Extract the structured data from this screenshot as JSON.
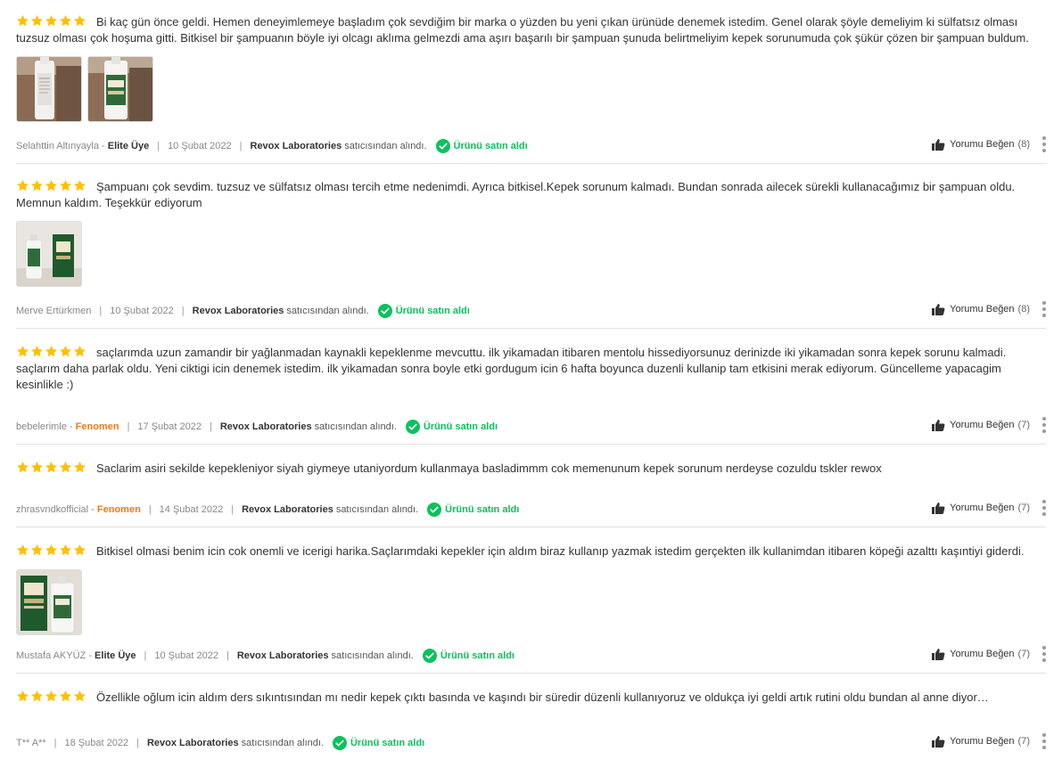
{
  "reviews": [
    {
      "rating": 5,
      "text": "Bi kaç gün önce geldi. Hemen deneyimlemeye başladım çok sevdiğim bir marka o yüzden bu yeni çıkan ürünüde denemek istedim. Genel olarak şöyle demeliyim ki sülfatsız olması tuzsuz olması çok hoşuma gitti. Bitkisel bir şampuanın böyle iyi olcagı aklıma gelmezdi ama aşırı başarılı bir şampuan şunuda belirtmeliyim kepek sorunumuda çok şükür çözen bir şampuan buldum.",
      "photos": [
        "bottle-back",
        "bottle-front"
      ],
      "user": "Selahttin Altınyayla",
      "badge": "Elite Üye",
      "badge_type": "elite",
      "date": "10 Şubat 2022",
      "seller": "Revox Laboratories",
      "seller_suffix": "satıcısından alındı.",
      "bought": "Ürünü satın aldı",
      "like_label": "Yorumu Beğen",
      "like_count": "(8)"
    },
    {
      "rating": 5,
      "text": "Şampuanı çok sevdim. tuzsuz ve sülfatsız olması tercih etme nedenimdi. Ayrıca bitkisel.Kepek sorunum kalmadı. Bundan sonrada ailecek sürekli kullanacağımız bir şampuan oldu. Memnun kaldım. Teşekkür ediyorum",
      "photos": [
        "two-products"
      ],
      "user": "Merve Ertürkmen",
      "badge": "",
      "badge_type": "",
      "date": "10 Şubat 2022",
      "seller": "Revox Laboratories",
      "seller_suffix": "satıcısından alındı.",
      "bought": "Ürünü satın aldı",
      "like_label": "Yorumu Beğen",
      "like_count": "(8)"
    },
    {
      "rating": 5,
      "text": "saçlarımda uzun zamandir bir yağlanmadan kaynakli kepeklenme mevcuttu. ilk yikamadan itibaren mentolu hissediyorsunuz derinizde iki yikamadan sonra kepek sorunu kalmadi. saçlarım daha parlak oldu. Yeni ciktigi icin denemek istedim. ilk yikamadan sonra boyle etki gordugum icin 6 hafta boyunca duzenli kullanip tam etkisini merak ediyorum. Güncelleme yapacagim kesinlikle :)",
      "photos": [],
      "user": "bebelerimle",
      "badge": "Fenomen",
      "badge_type": "fenomen",
      "date": "17 Şubat 2022",
      "seller": "Revox Laboratories",
      "seller_suffix": "satıcısından alındı.",
      "bought": "Ürünü satın aldı",
      "like_label": "Yorumu Beğen",
      "like_count": "(7)"
    },
    {
      "rating": 5,
      "text": "Saclarim asiri sekilde kepekleniyor siyah giymeye utaniyordum kullanmaya basladimmm cok memenunum kepek sorunum nerdeyse cozuldu tskler rewox",
      "photos": [],
      "user": "zhrasvndkofficial",
      "badge": "Fenomen",
      "badge_type": "fenomen",
      "date": "14 Şubat 2022",
      "seller": "Revox Laboratories",
      "seller_suffix": "satıcısından alındı.",
      "bought": "Ürünü satın aldı",
      "like_label": "Yorumu Beğen",
      "like_count": "(7)"
    },
    {
      "rating": 5,
      "text": "Bitkisel olmasi benim icin cok onemli ve icerigi harika.Saçlarımdaki kepekler için aldım biraz kullanıp yazmak istedim gerçekten ilk kullanimdan itibaren köpeği azalttı kaşıntiyi giderdi.",
      "photos": [
        "box-and-bottle"
      ],
      "user": "Mustafa AKYÜZ",
      "badge": "Elite Üye",
      "badge_type": "elite",
      "date": "10 Şubat 2022",
      "seller": "Revox Laboratories",
      "seller_suffix": "satıcısından alındı.",
      "bought": "Ürünü satın aldı",
      "like_label": "Yorumu Beğen",
      "like_count": "(7)"
    },
    {
      "rating": 5,
      "text": "Özellikle oğlum icin aldım ders sıkıntısından mı nedir kepek çıktı basında ve kaşındı bir süredir düzenli kullanıyoruz ve oldukça iyi geldi artık rutini oldu bundan al anne diyor…",
      "photos": [],
      "user": "T** A**",
      "badge": "",
      "badge_type": "",
      "date": "18 Şubat 2022",
      "seller": "Revox Laboratories",
      "seller_suffix": "satıcısından alındı.",
      "bought": "Ürünü satın aldı",
      "like_label": "Yorumu Beğen",
      "like_count": "(7)"
    }
  ],
  "colors": {
    "star": "#ffc000",
    "bought": "#0bc15c",
    "fenomen": "#f27a1a",
    "divider": "#e2e2e2"
  }
}
